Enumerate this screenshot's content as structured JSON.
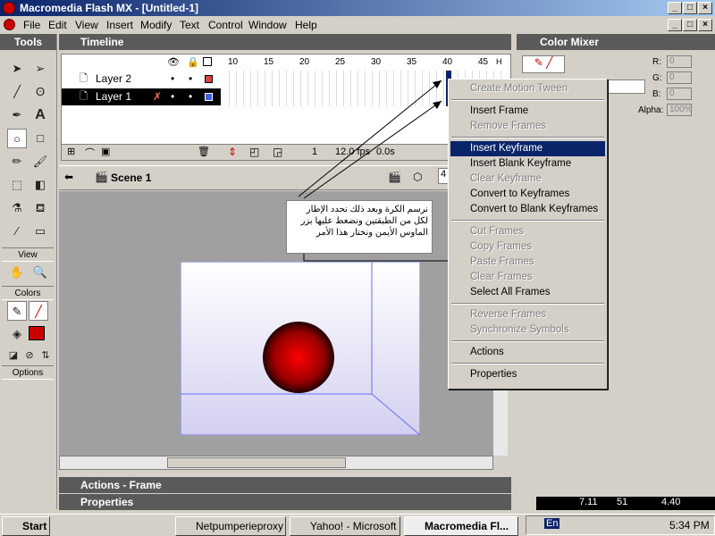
{
  "window": {
    "title": "Macromedia Flash MX - [Untitled-1]"
  },
  "menu": {
    "items": [
      "File",
      "Edit",
      "View",
      "Insert",
      "Modify",
      "Text",
      "Control",
      "Window",
      "Help"
    ]
  },
  "tools": {
    "header": "Tools",
    "view_label": "View",
    "colors_label": "Colors",
    "options_label": "Options",
    "text_tool": "A"
  },
  "timeline": {
    "header": "Timeline",
    "layers": [
      {
        "name": "Layer 2"
      },
      {
        "name": "Layer 1"
      }
    ],
    "ruler": [
      "10",
      "15",
      "20",
      "25",
      "30",
      "35",
      "40",
      "45"
    ],
    "ruler_h": "H",
    "current_frame": "1",
    "fps": "12.0 fps",
    "time": "0.0s"
  },
  "stage": {
    "scene": "Scene 1",
    "zoom": "4"
  },
  "color_mixer": {
    "header": "Color Mixer",
    "r_label": "R:",
    "g_label": "G:",
    "b_label": "B:",
    "alpha_label": "Alpha:",
    "r": "0",
    "g": "0",
    "b": "0",
    "alpha": "100%"
  },
  "context_menu": {
    "items": [
      {
        "label": "Create Motion Tween",
        "disabled": true
      },
      {
        "sep": true
      },
      {
        "label": "Insert Frame",
        "disabled": false
      },
      {
        "label": "Remove Frames",
        "disabled": true
      },
      {
        "sep": true
      },
      {
        "label": "Insert Keyframe",
        "disabled": false,
        "selected": true
      },
      {
        "label": "Insert Blank Keyframe",
        "disabled": false
      },
      {
        "label": "Clear Keyframe",
        "disabled": true
      },
      {
        "label": "Convert to Keyframes",
        "disabled": false
      },
      {
        "label": "Convert to Blank Keyframes",
        "disabled": false
      },
      {
        "sep": true
      },
      {
        "label": "Cut Frames",
        "disabled": true
      },
      {
        "label": "Copy Frames",
        "disabled": true
      },
      {
        "label": "Paste Frames",
        "disabled": true
      },
      {
        "label": "Clear Frames",
        "disabled": true
      },
      {
        "label": "Select All Frames",
        "disabled": false
      },
      {
        "sep": true
      },
      {
        "label": "Reverse Frames",
        "disabled": true
      },
      {
        "label": "Synchronize Symbols",
        "disabled": true
      },
      {
        "sep": true
      },
      {
        "label": "Actions",
        "disabled": false
      },
      {
        "sep": true
      },
      {
        "label": "Properties",
        "disabled": false
      }
    ]
  },
  "annotation": {
    "text": "نرسم الكرة وبعد ذلك نحدد الإطار لكل من الطبقتين ونضغط عليها بزر الماوس الأيمن ونختار هذا الأمر"
  },
  "panels": {
    "actions": "Actions - Frame",
    "properties": "Properties"
  },
  "taskbar": {
    "start": "Start",
    "items": [
      "Netpumperieproxy",
      "Yahoo! - Microsoft ...",
      "Macromedia Fl..."
    ],
    "lang": "En",
    "clock": "5:34 PM",
    "meter": [
      "7.11",
      "51",
      "4.40"
    ]
  },
  "colors": {
    "accent": "#0a246a",
    "ball": "#cc0000",
    "layer2_swatch": "#e04040",
    "layer1_swatch": "#4060e0"
  }
}
